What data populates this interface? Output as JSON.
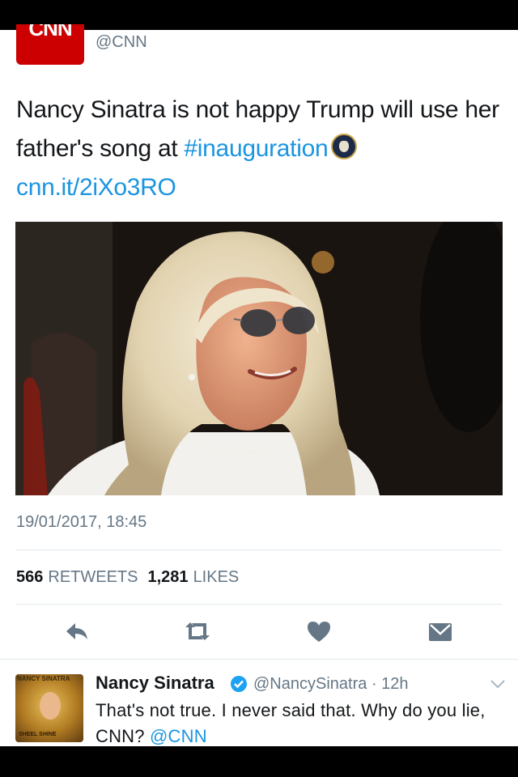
{
  "tweet": {
    "author_logo_text": "CNN",
    "handle": "@CNN",
    "text_part1": "Nancy Sinatra is not happy Trump will use her father's song at ",
    "hashtag": "#inauguration",
    "link": "cnn.it/2iXo3RO",
    "timestamp": "19/01/2017, 18:45",
    "retweets_count": "566",
    "retweets_label": "RETWEETS",
    "likes_count": "1,281",
    "likes_label": "LIKES"
  },
  "actions": [
    "reply-icon",
    "retweet-icon",
    "like-heart-icon",
    "direct-message-icon"
  ],
  "reply": {
    "avatar_caption_top": "NANCY SINATRA",
    "avatar_caption_bottom": "SHEEL SHINE",
    "name": "Nancy Sinatra",
    "handle": "@NancySinatra",
    "time": "· 12h",
    "text": "That's not true. I never said that. Why do you lie, CNN? ",
    "mention": "@CNN"
  },
  "colors": {
    "link": "#1b95e0",
    "secondary_text": "#657786",
    "cnn_red": "#cc0000",
    "verified_blue": "#1da1f2"
  }
}
